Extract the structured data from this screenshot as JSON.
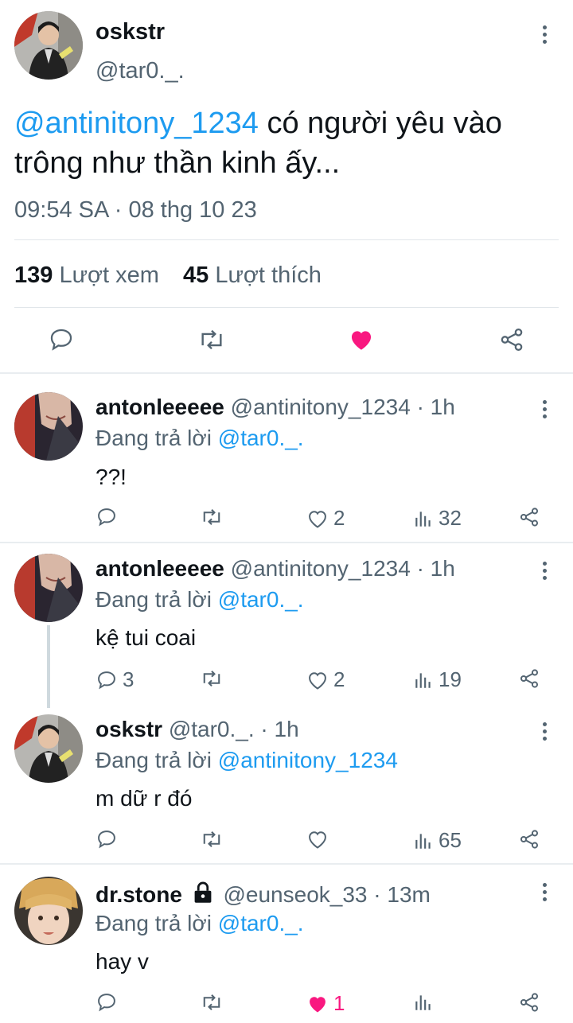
{
  "colors": {
    "accent": "#1d9bf0",
    "like": "#f91880",
    "text": "#0f1419",
    "muted": "#536471"
  },
  "main_tweet": {
    "display_name": "oskstr",
    "handle": "@tar0._.",
    "mention": "@antinitony_1234",
    "text_line1_rest": " có người yêu vào",
    "text_line2": "trông như thần kinh ấy...",
    "timestamp": "09:54 SA · 08 thg 10 23",
    "views_count": "139",
    "views_label": "Lượt xem",
    "likes_count": "45",
    "likes_label": "Lượt thích",
    "icons": [
      "reply-icon",
      "retweet-icon",
      "like-icon-filled",
      "share-icon"
    ]
  },
  "replies": [
    {
      "display_name": "antonleeeee",
      "handle_time": "@antinitony_1234 · 1h",
      "replying_prefix": "Đang trả lời ",
      "replying_to": "@tar0._.",
      "text": "??!",
      "reply_count": "",
      "like_count": "2",
      "view_count": "32"
    },
    {
      "display_name": "antonleeeee",
      "handle_time": "@antinitony_1234 · 1h",
      "replying_prefix": "Đang trả lời ",
      "replying_to": "@tar0._.",
      "text": "kệ tui coai",
      "reply_count": "3",
      "like_count": "2",
      "view_count": "19"
    },
    {
      "display_name": "oskstr",
      "handle_time": "@tar0._. · 1h",
      "replying_prefix": "Đang trả lời ",
      "replying_to": "@antinitony_1234",
      "text": "m dữ r đó",
      "reply_count": "",
      "like_count": "",
      "view_count": "65"
    },
    {
      "display_name": "dr.stone",
      "handle_time": "@eunseok_33 · 13m",
      "replying_prefix": "Đang trả lời ",
      "replying_to": "@tar0._.",
      "text": "hay v",
      "reply_count": "",
      "like_count": "1",
      "view_count": "",
      "locked": true,
      "liked": true
    }
  ]
}
